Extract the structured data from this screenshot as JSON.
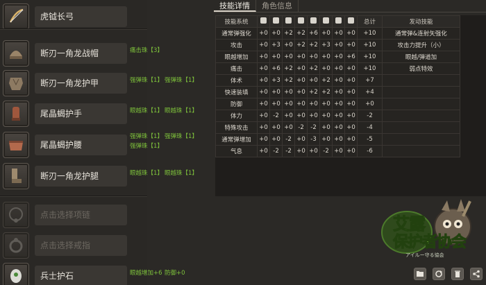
{
  "equipment": [
    {
      "icon": "bow-icon",
      "name": "虎钺长弓",
      "decorations": []
    },
    {
      "icon": "helmet-icon",
      "name": "断刃一角龙战帽",
      "decorations": [
        "痛击珠【3】"
      ]
    },
    {
      "icon": "chest-armor-icon",
      "name": "断刃一角龙护甲",
      "decorations": [
        "强弹珠【1】",
        "强弹珠【1】"
      ]
    },
    {
      "icon": "gauntlet-icon",
      "name": "尾晶蝎护手",
      "decorations": [
        "眼越珠【1】",
        "眼越珠【1】"
      ]
    },
    {
      "icon": "waist-icon",
      "name": "尾晶蝎护腰",
      "decorations": [
        "强弹珠【1】",
        "强弹珠【1】",
        "强弹珠【1】"
      ]
    },
    {
      "icon": "leg-armor-icon",
      "name": "断刃一角龙护腿",
      "decorations": [
        "眼越珠【1】",
        "眼越珠【1】"
      ]
    },
    {
      "icon": "necklace-icon",
      "name": "点击选择项链",
      "decorations": [],
      "empty": true
    },
    {
      "icon": "ring-icon",
      "name": "点击选择戒指",
      "decorations": [],
      "empty": true
    },
    {
      "icon": "talisman-icon",
      "name": "兵士护石",
      "decorations": [
        "眼越增加+6",
        "防御+0"
      ]
    }
  ],
  "tabs": [
    "技能详情",
    "角色信息"
  ],
  "skill_table": {
    "headers": {
      "name": "技能系统",
      "slot_icons": [
        "weapon-icon",
        "helmet-icon",
        "chest-icon",
        "arm-icon",
        "waist-icon",
        "leg-icon",
        "necklace-icon",
        "ring-icon"
      ],
      "total": "总计",
      "effect": "发动技能"
    },
    "rows": [
      {
        "name": "通常弹强化",
        "values": [
          "+0",
          "+0",
          "+2",
          "+2",
          "+6",
          "+0",
          "+0",
          "+0"
        ],
        "total": "+10",
        "effect": "通常弹&连射矢强化"
      },
      {
        "name": "攻击",
        "values": [
          "+0",
          "+3",
          "+0",
          "+2",
          "+2",
          "+3",
          "+0",
          "+0"
        ],
        "total": "+10",
        "effect": "攻击力提升（小）"
      },
      {
        "name": "眼越增加",
        "values": [
          "+0",
          "+0",
          "+0",
          "+0",
          "+0",
          "+0",
          "+0",
          "+6"
        ],
        "total": "+10",
        "effect": "眼越/弹道加"
      },
      {
        "name": "痛击",
        "values": [
          "+0",
          "+6",
          "+2",
          "+0",
          "+2",
          "+0",
          "+0",
          "+0"
        ],
        "total": "+10",
        "effect": "弱点特效"
      },
      {
        "name": "体术",
        "values": [
          "+0",
          "+3",
          "+2",
          "+0",
          "+0",
          "+2",
          "+0",
          "+0"
        ],
        "total": "+7",
        "effect": ""
      },
      {
        "name": "快速装填",
        "values": [
          "+0",
          "+0",
          "+0",
          "+0",
          "+2",
          "+2",
          "+0",
          "+0"
        ],
        "total": "+4",
        "effect": ""
      },
      {
        "name": "防御",
        "values": [
          "+0",
          "+0",
          "+0",
          "+0",
          "+0",
          "+0",
          "+0",
          "+0"
        ],
        "total": "+0",
        "effect": ""
      },
      {
        "name": "体力",
        "values": [
          "+0",
          "-2",
          "+0",
          "+0",
          "+0",
          "+0",
          "+0",
          "+0"
        ],
        "total": "-2",
        "effect": ""
      },
      {
        "name": "特殊攻击",
        "values": [
          "+0",
          "+0",
          "+0",
          "-2",
          "-2",
          "+0",
          "+0",
          "+0"
        ],
        "total": "-4",
        "effect": ""
      },
      {
        "name": "通常弹增加",
        "values": [
          "+0",
          "+0",
          "-2",
          "+0",
          "-3",
          "+0",
          "+0",
          "+0"
        ],
        "total": "-5",
        "effect": ""
      },
      {
        "name": "气息",
        "values": [
          "+0",
          "-2",
          "-2",
          "+0",
          "+0",
          "-2",
          "+0",
          "+0"
        ],
        "total": "-6",
        "effect": ""
      }
    ]
  },
  "logo": {
    "line1": "艾露",
    "line2": "保护者协会",
    "subtitle": "アイルー守る協会"
  },
  "toolbar": [
    "folder-icon",
    "refresh-icon",
    "trash-icon",
    "share-icon"
  ]
}
